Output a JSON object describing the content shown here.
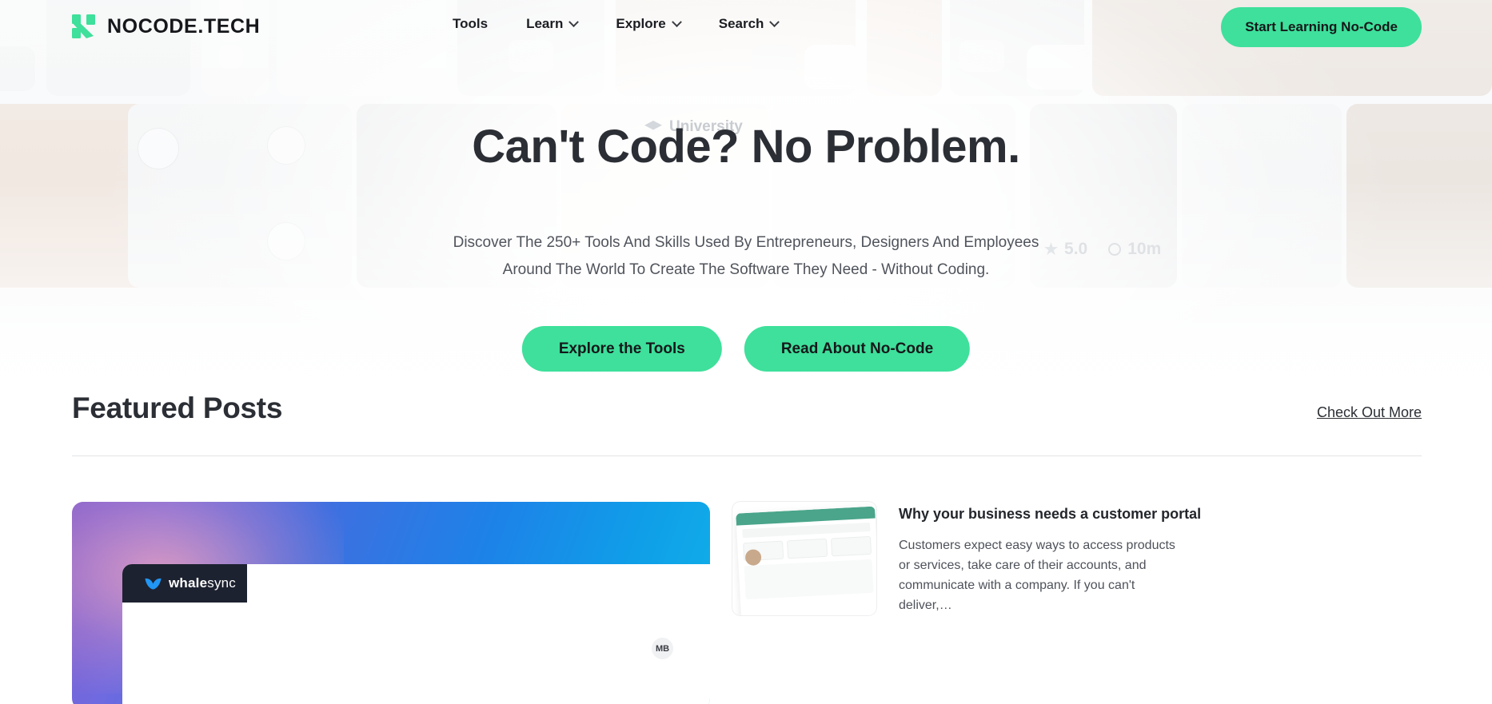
{
  "brand": {
    "name": "NOCODE.TECH",
    "logo_icon": "nocode-n-logo",
    "accent": "#3ee09b",
    "ink": "#2b2e34"
  },
  "nav": {
    "items": [
      {
        "label": "Tools",
        "has_dropdown": false,
        "icon": ""
      },
      {
        "label": "Learn",
        "has_dropdown": true,
        "icon": "chevron-down-icon"
      },
      {
        "label": "Explore",
        "has_dropdown": true,
        "icon": "chevron-down-icon"
      },
      {
        "label": "Search",
        "has_dropdown": true,
        "icon": "chevron-down-icon"
      }
    ],
    "cta_label": "Start Learning No-Code"
  },
  "hero": {
    "title": "Can't Code? No Problem.",
    "subtitle_line1": "Discover The 250+ Tools And Skills Used By Entrepreneurs, Designers And Employees",
    "subtitle_line2": "Around The World To Create The Software They Need - Without Coding.",
    "primary_button": "Explore the Tools",
    "secondary_button": "Read About No-Code",
    "background_labels": {
      "university": "University",
      "rating": "5.0",
      "duration": "10m",
      "star_icon": "star-icon",
      "clock_icon": "clock-icon",
      "cap_icon": "graduation-cap-icon"
    }
  },
  "featured": {
    "title": "Featured Posts",
    "more_link": "Check Out More",
    "big_card": {
      "brand_plain": "whale",
      "brand_bold": "sync",
      "logo_icon": "whalesync-logo-icon",
      "avatar_initials": "MB"
    },
    "article": {
      "title": "Why your business needs a customer portal",
      "excerpt": "Customers expect easy ways to access products or services, take care of their accounts, and communicate with a company. If you can't deliver,…",
      "thumbnail_icon": "tripreveal-screenshot-thumbnail"
    }
  }
}
